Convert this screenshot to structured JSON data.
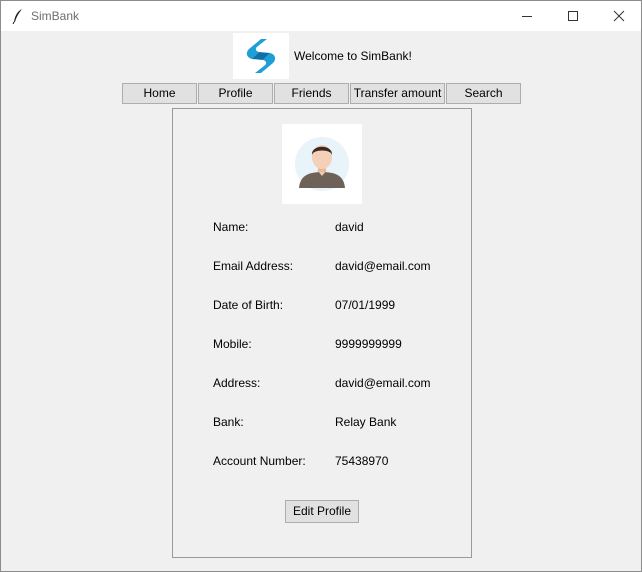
{
  "window": {
    "title": "SimBank"
  },
  "header": {
    "welcome": "Welcome to SimBank!",
    "logo_icon": "simbank-logo"
  },
  "nav": {
    "home": "Home",
    "profile": "Profile",
    "friends": "Friends",
    "transfer": "Transfer amount",
    "search": "Search"
  },
  "profile": {
    "avatar_icon": "user-avatar",
    "fields": [
      {
        "label": "Name:",
        "value": "david"
      },
      {
        "label": "Email Address:",
        "value": "david@email.com"
      },
      {
        "label": "Date of Birth:",
        "value": "07/01/1999"
      },
      {
        "label": "Mobile:",
        "value": "9999999999"
      },
      {
        "label": "Address:",
        "value": "david@email.com"
      },
      {
        "label": "Bank:",
        "value": "Relay Bank"
      },
      {
        "label": "Account Number:",
        "value": "75438970"
      }
    ],
    "edit_label": "Edit Profile"
  },
  "colors": {
    "accent": "#1e9fd6",
    "background": "#f0f0f0",
    "button": "#e1e1e1"
  }
}
